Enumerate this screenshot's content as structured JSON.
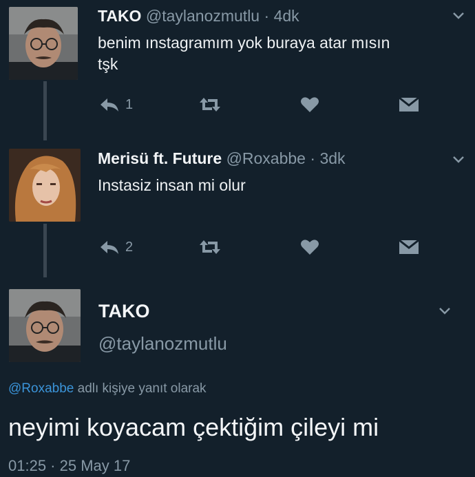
{
  "tweets": [
    {
      "name": "TAKO",
      "handle": "@taylanozmutlu",
      "separator": "·",
      "time": "4dk",
      "text_line1": "benim ınstagramım yok buraya atar mısın",
      "text_line2": "tşk",
      "reply_count": "1"
    },
    {
      "name": "Merisü ft. Future",
      "handle": "@Roxabbe",
      "separator": "·",
      "time": "3dk",
      "text_line1": "Instasiz insan mi olur",
      "reply_count": "2"
    }
  ],
  "focused": {
    "name": "TAKO",
    "handle": "@taylanozmutlu",
    "reply_mention": "@Roxabbe",
    "reply_suffix": " adlı kişiye yanıt olarak",
    "text": "neyimi koyacam çektiğim çileyi mi",
    "timestamp": "01:25 · 25 May 17"
  },
  "icons": {
    "reply": "reply-arrow-icon",
    "retweet": "retweet-icon",
    "like": "heart-icon",
    "dm": "envelope-icon",
    "more": "chevron-down-icon"
  },
  "colors": {
    "background": "#13202b",
    "secondary_text": "#8899a6",
    "mention": "#3b94d9",
    "thread_line": "#3a4651"
  }
}
